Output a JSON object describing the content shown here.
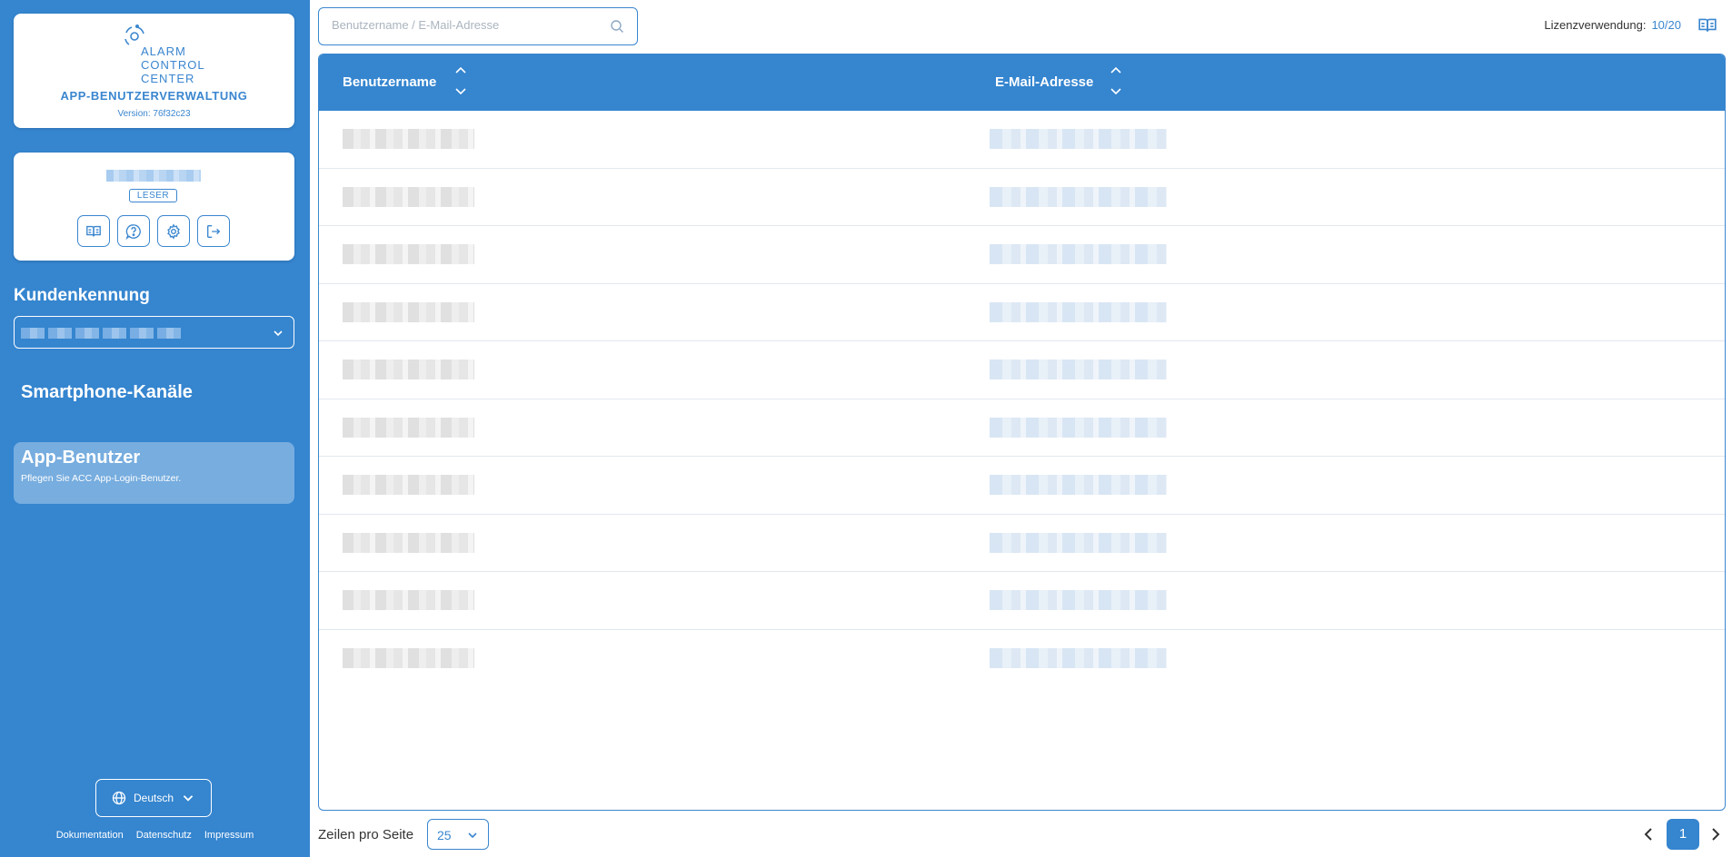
{
  "sidebar": {
    "logo": {
      "line1": "ALARM",
      "line2": "CONTROL",
      "line3": "CENTER"
    },
    "app_title": "APP-BENUTZERVERWALTUNG",
    "version": "Version: 76f32c23",
    "user": {
      "role": "LESER"
    },
    "customer_label": "Kundenkennung",
    "nav": [
      {
        "title": "Smartphone-Kanäle",
        "subtitle": "",
        "active": false
      },
      {
        "title": "App-Benutzer",
        "subtitle": "Pflegen Sie ACC App-Login-Benutzer.",
        "active": true
      }
    ],
    "language": "Deutsch",
    "footer_links": [
      "Dokumentation",
      "Datenschutz",
      "Impressum"
    ]
  },
  "search": {
    "placeholder": "Benutzername / E-Mail-Adresse",
    "value": ""
  },
  "license": {
    "label": "Lizenzverwendung:",
    "value": "10/20"
  },
  "table": {
    "columns": [
      "Benutzername",
      "E-Mail-Adresse"
    ]
  },
  "pagination": {
    "rows_label": "Zeilen pro Seite",
    "rows_per_page": "25",
    "current_page": "1"
  },
  "colors": {
    "primary": "#3585cf",
    "nav_active": "#77addf",
    "accent_text": "#3a86cf"
  }
}
